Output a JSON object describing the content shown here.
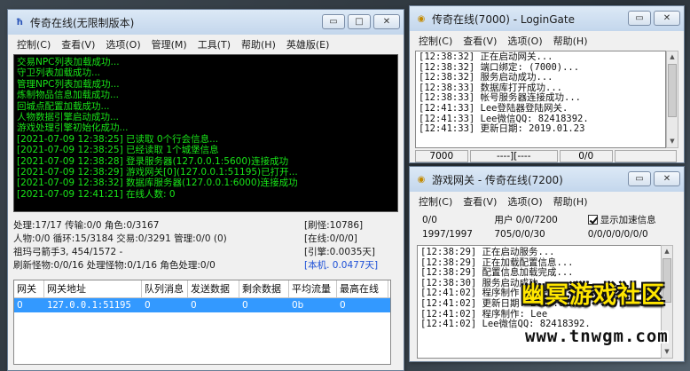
{
  "main_window": {
    "title": "传奇在线(无限制版本)",
    "menu": [
      "控制(C)",
      "查看(V)",
      "选项(O)",
      "管理(M)",
      "工具(T)",
      "帮助(H)",
      "英雄版(E)"
    ],
    "log_lines": [
      "交易NPC列表加载成功...",
      "守卫列表加载成功...",
      "管理NPC列表加载成功...",
      "炼制物品信息加载成功...",
      "回城点配置加载成功...",
      "人物数据引擎启动成功...",
      "游戏处理引擎初始化成功...",
      "[2021-07-09 12:38:25] 已读取 0个行会信息...",
      "[2021-07-09 12:38:25] 已经读取 1个城堡信息",
      "[2021-07-09 12:38:28] 登录服务器(127.0.0.1:5600)连接成功",
      "[2021-07-09 12:38:29] 游戏网关[0](127.0.0.1:51195)已打开...",
      "[2021-07-09 12:38:32] 数据库服务器(127.0.0.1:6000)连接成功",
      "[2021-07-09 12:41:21] 在线人数: 0"
    ],
    "status_rows": [
      {
        "left": "处理:17/17 传输:0/0 角色:0/3167",
        "right": "[刷怪:10786]"
      },
      {
        "left": "人物:0/0 循环:15/3184 交易:0/3291 管理:0/0 (0)",
        "right": "[在线:0/0/0]"
      },
      {
        "left": "祖玛弓箭手3, 454/1572 -",
        "right": "[引擎:0.0035天]"
      },
      {
        "left": "刷新怪物:0/0/16 处理怪物:0/1/16 角色处理:0/0",
        "right": "[本机. 0.0477天]"
      }
    ],
    "table": {
      "headers": [
        "网关",
        "网关地址",
        "队列消息",
        "发送数据",
        "剩余数据",
        "平均流量",
        "最高在线"
      ],
      "rows": [
        [
          "0",
          "127.0.0.1:51195",
          "0",
          "0",
          "0",
          "0b",
          "0"
        ]
      ]
    },
    "colors": {
      "log_bg": "#000000",
      "log_text": "#19e519",
      "selection": "#3399ff",
      "highlight_text": "#1c4fd6"
    }
  },
  "gate_window": {
    "title": "传奇在线(7000) - LoginGate",
    "menu": [
      "控制(C)",
      "查看(V)",
      "选项(O)",
      "帮助(H)"
    ],
    "log_lines": [
      "[12:38:32] 正在启动网关...",
      "[12:38:32] 端口绑定: (7000)...",
      "[12:38:32] 服务启动成功...",
      "[12:38:33] 数据库打开成功...",
      "[12:38:33] 帐号服务器连接成功...",
      "[12:41:33] Lee登陆器登陆网关.",
      "[12:41:33] Lee微信QQ: 82418392.",
      "[12:41:33] 更新日期: 2019.01.23"
    ],
    "status": [
      "7000",
      "----][----",
      "0/0"
    ]
  },
  "game_window": {
    "title": "游戏网关 - 传奇在线(7200)",
    "menu": [
      "控制(C)",
      "查看(V)",
      "选项(O)",
      "帮助(H)"
    ],
    "info_row1": {
      "a": "0/0",
      "b": "用户 0/0/7200",
      "check_label": "显示加速信息",
      "checked": true
    },
    "info_row2": {
      "a": "1997/1997",
      "b": "705/0/0/30",
      "c": "0/0/0/0/0/0/0"
    },
    "log_lines": [
      "[12:38:29] 正在启动服务...",
      "[12:38:29] 正在加载配置信息...",
      "[12:38:29] 配置信息加载完成...",
      "[12:38:30] 服务启动成功...",
      "[12:41:02] 程序制作: Lee",
      "[12:41:02] 更新日期: 2019.01.23",
      "[12:41:02] 程序制作: Lee",
      "[12:41:02] Lee微信QQ: 82418392."
    ]
  },
  "watermark": {
    "title": "幽冥游戏社区",
    "url": "www.tnwgm.com"
  }
}
